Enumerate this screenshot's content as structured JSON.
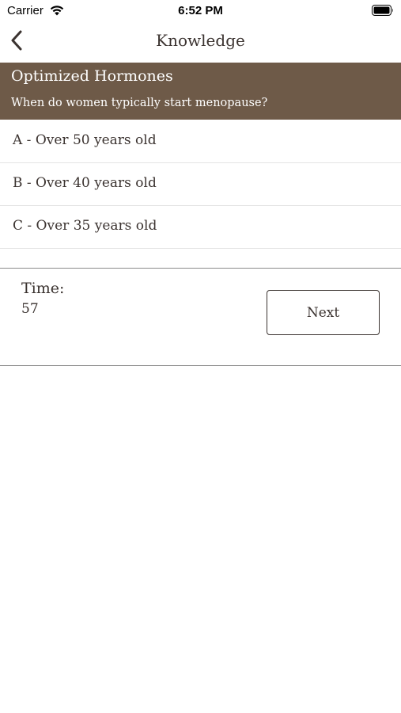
{
  "status_bar": {
    "carrier": "Carrier",
    "time": "6:52 PM",
    "wifi_icon": "wifi-icon",
    "battery_icon": "battery-icon"
  },
  "nav": {
    "title": "Knowledge",
    "back_icon": "chevron-left-icon"
  },
  "quiz": {
    "category": "Optimized Hormones",
    "question": "When do women typically start menopause?",
    "answers": [
      "A - Over 50 years old",
      "B - Over 40 years old",
      "C - Over 35 years old"
    ]
  },
  "footer": {
    "time_label": "Time:",
    "time_value": "57",
    "next_label": "Next"
  },
  "colors": {
    "header_bg": "#6e5a48",
    "text": "#3b3330",
    "divider": "#e3e3e3"
  }
}
